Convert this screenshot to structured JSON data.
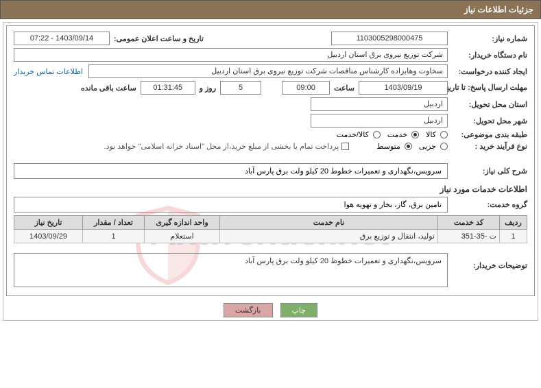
{
  "header": {
    "title": "جزئیات اطلاعات نیاز"
  },
  "top": {
    "need_number_label": "شماره نیاز:",
    "need_number": "1103005298000475",
    "announce_label": "تاریخ و ساعت اعلان عمومی:",
    "announce_value": "1403/09/14 - 07:22",
    "buyer_org_label": "نام دستگاه خریدار:",
    "buyer_org": "شرکت توزیع نیروی برق استان اردبیل",
    "requester_label": "ایجاد کننده درخواست:",
    "requester": "سخاوت وهابزاده کارشناس مناقصات شرکت توزیع نیروی برق استان اردبیل",
    "contact_link": "اطلاعات تماس خریدار",
    "deadline_label": "مهلت ارسال پاسخ: تا تاریخ:",
    "deadline_date": "1403/09/19",
    "time_label": "ساعت",
    "deadline_time": "09:00",
    "days_value": "5",
    "days_and": "روز و",
    "remain_time": "01:31:45",
    "remain_label": "ساعت باقی مانده",
    "delivery_province_label": "استان محل تحویل:",
    "delivery_province": "اردبیل",
    "delivery_city_label": "شهر محل تحویل:",
    "delivery_city": "اردبیل",
    "category_label": "طبقه بندی موضوعی:",
    "cat_goods": "کالا",
    "cat_service": "خدمت",
    "cat_both": "کالا/خدمت",
    "process_label": "نوع فرآیند خرید :",
    "proc_small": "جزیی",
    "proc_medium": "متوسط",
    "payment_note": "پرداخت تمام یا بخشی از مبلغ خرید،از محل \"اسناد خزانه اسلامی\" خواهد بود."
  },
  "mid": {
    "general_desc_label": "شرح کلی نیاز:",
    "general_desc": "سرویس،نگهداری و تعمیرات خطوط 20 کیلو ولت برق پارس آباد",
    "services_info_label": "اطلاعات خدمات مورد نیاز",
    "service_group_label": "گروه خدمت:",
    "service_group": "تامین برق، گاز، بخار و تهویه هوا"
  },
  "table": {
    "headers": {
      "row": "ردیف",
      "code": "کد خدمت",
      "name": "نام خدمت",
      "unit": "واحد اندازه گیری",
      "qty": "تعداد / مقدار",
      "date": "تاریخ نیاز"
    },
    "rows": [
      {
        "row": "1",
        "code": "ت -35-351",
        "name": "تولید، انتقال و توزیع برق",
        "unit": "استعلام",
        "qty": "1",
        "date": "1403/09/29"
      }
    ]
  },
  "buyer_notes_label": "توضیحات خریدار:",
  "buyer_notes": "سرویس،نگهداری و تعمیرات خطوط 20 کیلو ولت برق پارس آباد",
  "buttons": {
    "print": "چاپ",
    "back": "بازگشت"
  },
  "watermark": "AriaTender.net"
}
